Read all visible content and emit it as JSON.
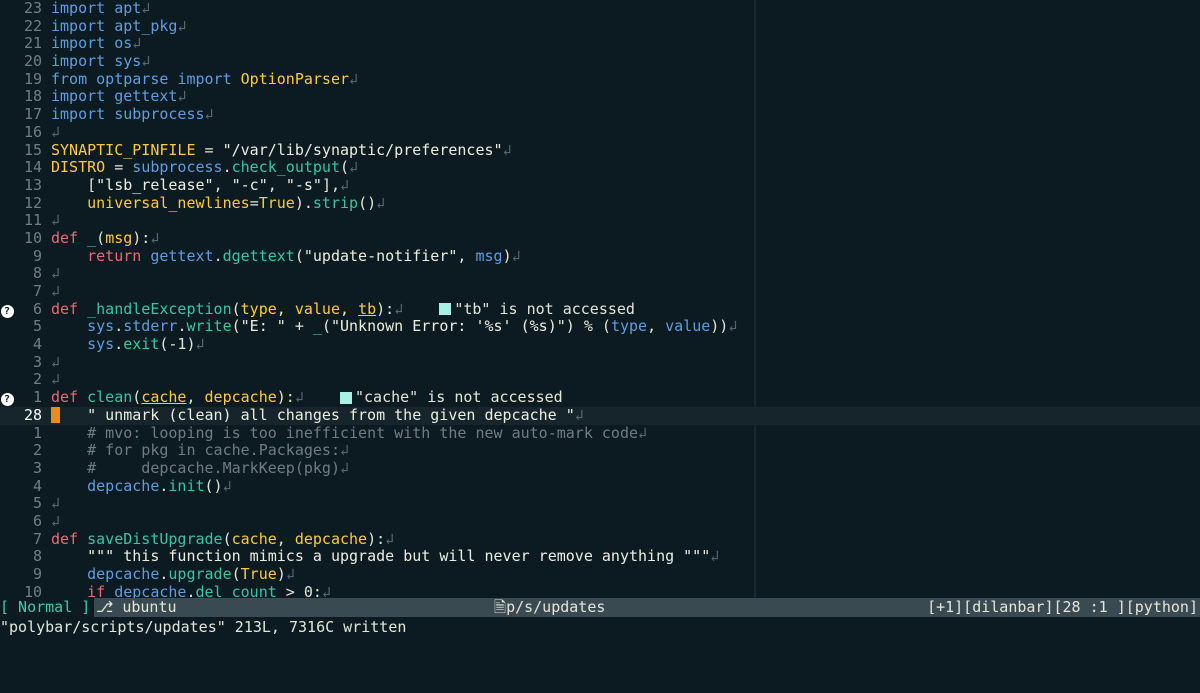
{
  "editor": {
    "lines": [
      {
        "n": "23",
        "tokens": [
          [
            "kw",
            "import"
          ],
          [
            "plain",
            " "
          ],
          [
            "kw",
            "apt"
          ],
          [
            "eol",
            "↲"
          ]
        ]
      },
      {
        "n": "22",
        "tokens": [
          [
            "kw",
            "import"
          ],
          [
            "plain",
            " "
          ],
          [
            "kw",
            "apt_pkg"
          ],
          [
            "eol",
            "↲"
          ]
        ]
      },
      {
        "n": "21",
        "tokens": [
          [
            "kw",
            "import"
          ],
          [
            "plain",
            " "
          ],
          [
            "kw",
            "os"
          ],
          [
            "eol",
            "↲"
          ]
        ]
      },
      {
        "n": "20",
        "tokens": [
          [
            "kw",
            "import"
          ],
          [
            "plain",
            " "
          ],
          [
            "kw",
            "sys"
          ],
          [
            "eol",
            "↲"
          ]
        ]
      },
      {
        "n": "19",
        "tokens": [
          [
            "kw",
            "from"
          ],
          [
            "plain",
            " "
          ],
          [
            "kw",
            "optparse"
          ],
          [
            "plain",
            " "
          ],
          [
            "kw",
            "import"
          ],
          [
            "plain",
            " "
          ],
          [
            "cnst",
            "OptionParser"
          ],
          [
            "eol",
            "↲"
          ]
        ]
      },
      {
        "n": "18",
        "tokens": [
          [
            "kw",
            "import"
          ],
          [
            "plain",
            " "
          ],
          [
            "kw",
            "gettext"
          ],
          [
            "eol",
            "↲"
          ]
        ]
      },
      {
        "n": "17",
        "tokens": [
          [
            "kw",
            "import"
          ],
          [
            "plain",
            " "
          ],
          [
            "kw",
            "subprocess"
          ],
          [
            "eol",
            "↲"
          ]
        ]
      },
      {
        "n": "16",
        "tokens": [
          [
            "eol",
            "↲"
          ]
        ]
      },
      {
        "n": "15",
        "tokens": [
          [
            "cnst",
            "SYNAPTIC_PINFILE"
          ],
          [
            "plain",
            " = "
          ],
          [
            "str",
            "\"/var/lib/synaptic/preferences\""
          ],
          [
            "eol",
            "↲"
          ]
        ]
      },
      {
        "n": "14",
        "tokens": [
          [
            "cnst",
            "DISTRO"
          ],
          [
            "plain",
            " = "
          ],
          [
            "kw",
            "subprocess"
          ],
          [
            "plain",
            "."
          ],
          [
            "fn",
            "check_output"
          ],
          [
            "plain",
            "("
          ],
          [
            "eol",
            "↲"
          ]
        ]
      },
      {
        "n": "13",
        "tokens": [
          [
            "plain",
            "    ["
          ],
          [
            "str",
            "\"lsb_release\""
          ],
          [
            "plain",
            ", "
          ],
          [
            "str",
            "\"-c\""
          ],
          [
            "plain",
            ", "
          ],
          [
            "str",
            "\"-s\""
          ],
          [
            "plain",
            "],"
          ],
          [
            "eol",
            "↲"
          ]
        ]
      },
      {
        "n": "12",
        "tokens": [
          [
            "plain",
            "    "
          ],
          [
            "var",
            "universal_newlines"
          ],
          [
            "plain",
            "="
          ],
          [
            "cnst",
            "True"
          ],
          [
            "plain",
            ")."
          ],
          [
            "fn",
            "strip"
          ],
          [
            "plain",
            "()"
          ],
          [
            "eol",
            "↲"
          ]
        ]
      },
      {
        "n": "11",
        "tokens": [
          [
            "eol",
            "↲"
          ]
        ]
      },
      {
        "n": "10",
        "tokens": [
          [
            "def",
            "def"
          ],
          [
            "plain",
            " "
          ],
          [
            "fn",
            "_"
          ],
          [
            "plain",
            "("
          ],
          [
            "var",
            "msg"
          ],
          [
            "plain",
            "):"
          ],
          [
            "eol",
            "↲"
          ]
        ]
      },
      {
        "n": "9",
        "tokens": [
          [
            "plain",
            "    "
          ],
          [
            "def",
            "return"
          ],
          [
            "plain",
            " "
          ],
          [
            "kw",
            "gettext"
          ],
          [
            "plain",
            "."
          ],
          [
            "fn",
            "dgettext"
          ],
          [
            "plain",
            "("
          ],
          [
            "str",
            "\"update-notifier\""
          ],
          [
            "plain",
            ", "
          ],
          [
            "kw",
            "msg"
          ],
          [
            "plain",
            ")"
          ],
          [
            "eol",
            "↲"
          ]
        ]
      },
      {
        "n": "8",
        "tokens": [
          [
            "eol",
            "↲"
          ]
        ]
      },
      {
        "n": "7",
        "tokens": [
          [
            "eol",
            "↲"
          ]
        ]
      },
      {
        "n": "6",
        "sign": "?",
        "tokens": [
          [
            "def",
            "def"
          ],
          [
            "plain",
            " "
          ],
          [
            "fn",
            "_handleException"
          ],
          [
            "plain",
            "("
          ],
          [
            "var",
            "type"
          ],
          [
            "plain",
            ", "
          ],
          [
            "var",
            "value"
          ],
          [
            "plain",
            ", "
          ],
          [
            "ul",
            "tb"
          ],
          [
            "plain",
            "):"
          ],
          [
            "eol",
            "↲"
          ],
          [
            "plain",
            "    "
          ],
          [
            "swatch",
            ""
          ],
          [
            "virt",
            "\"tb\" is not accessed"
          ]
        ]
      },
      {
        "n": "5",
        "tokens": [
          [
            "plain",
            "    "
          ],
          [
            "kw",
            "sys"
          ],
          [
            "plain",
            "."
          ],
          [
            "kw",
            "stderr"
          ],
          [
            "plain",
            "."
          ],
          [
            "fn",
            "write"
          ],
          [
            "plain",
            "("
          ],
          [
            "str",
            "\"E: \""
          ],
          [
            "plain",
            " + "
          ],
          [
            "fn",
            "_"
          ],
          [
            "plain",
            "("
          ],
          [
            "str",
            "\"Unknown Error: '%s' (%s)\""
          ],
          [
            "plain",
            ") % ("
          ],
          [
            "kw",
            "type"
          ],
          [
            "plain",
            ", "
          ],
          [
            "kw",
            "value"
          ],
          [
            "plain",
            "))"
          ],
          [
            "eol",
            "↲"
          ]
        ]
      },
      {
        "n": "4",
        "tokens": [
          [
            "plain",
            "    "
          ],
          [
            "kw",
            "sys"
          ],
          [
            "plain",
            "."
          ],
          [
            "fn",
            "exit"
          ],
          [
            "plain",
            "(-1)"
          ],
          [
            "eol",
            "↲"
          ]
        ]
      },
      {
        "n": "3",
        "tokens": [
          [
            "eol",
            "↲"
          ]
        ]
      },
      {
        "n": "2",
        "tokens": [
          [
            "eol",
            "↲"
          ]
        ]
      },
      {
        "n": "1",
        "sign": "?",
        "tokens": [
          [
            "def",
            "def"
          ],
          [
            "plain",
            " "
          ],
          [
            "fn",
            "clean"
          ],
          [
            "plain",
            "("
          ],
          [
            "ul",
            "cache"
          ],
          [
            "plain",
            ", "
          ],
          [
            "var",
            "depcache"
          ],
          [
            "plain",
            "):"
          ],
          [
            "eol",
            "↲"
          ],
          [
            "plain",
            "    "
          ],
          [
            "swatch",
            ""
          ],
          [
            "virt",
            "\"cache\" is not accessed"
          ]
        ]
      },
      {
        "n": "28",
        "current": true,
        "tokens": [
          [
            "cursor",
            ""
          ],
          [
            "plain",
            "   "
          ],
          [
            "str",
            "\" unmark (clean) all changes from the given depcache \""
          ],
          [
            "eol",
            "↲"
          ]
        ]
      },
      {
        "n": "1",
        "tokens": [
          [
            "plain",
            "    "
          ],
          [
            "cm",
            "# mvo: looping is too inefficient with the new auto-mark code"
          ],
          [
            "eol",
            "↲"
          ]
        ]
      },
      {
        "n": "2",
        "tokens": [
          [
            "plain",
            "    "
          ],
          [
            "cm",
            "# for pkg in cache.Packages:"
          ],
          [
            "eol",
            "↲"
          ]
        ]
      },
      {
        "n": "3",
        "tokens": [
          [
            "plain",
            "    "
          ],
          [
            "cm",
            "#     depcache.MarkKeep(pkg)"
          ],
          [
            "eol",
            "↲"
          ]
        ]
      },
      {
        "n": "4",
        "tokens": [
          [
            "plain",
            "    "
          ],
          [
            "kw",
            "depcache"
          ],
          [
            "plain",
            "."
          ],
          [
            "fn",
            "init"
          ],
          [
            "plain",
            "()"
          ],
          [
            "eol",
            "↲"
          ]
        ]
      },
      {
        "n": "5",
        "tokens": [
          [
            "eol",
            "↲"
          ]
        ]
      },
      {
        "n": "6",
        "tokens": [
          [
            "eol",
            "↲"
          ]
        ]
      },
      {
        "n": "7",
        "tokens": [
          [
            "def",
            "def"
          ],
          [
            "plain",
            " "
          ],
          [
            "fn",
            "saveDistUpgrade"
          ],
          [
            "plain",
            "("
          ],
          [
            "var",
            "cache"
          ],
          [
            "plain",
            ", "
          ],
          [
            "var",
            "depcache"
          ],
          [
            "plain",
            "):"
          ],
          [
            "eol",
            "↲"
          ]
        ]
      },
      {
        "n": "8",
        "tokens": [
          [
            "plain",
            "    "
          ],
          [
            "str",
            "\"\"\" this function mimics a upgrade but will never remove anything \"\"\""
          ],
          [
            "eol",
            "↲"
          ]
        ]
      },
      {
        "n": "9",
        "tokens": [
          [
            "plain",
            "    "
          ],
          [
            "kw",
            "depcache"
          ],
          [
            "plain",
            "."
          ],
          [
            "fn",
            "upgrade"
          ],
          [
            "plain",
            "("
          ],
          [
            "cnst",
            "True"
          ],
          [
            "plain",
            ")"
          ],
          [
            "eol",
            "↲"
          ]
        ]
      },
      {
        "n": "10",
        "tokens": [
          [
            "plain",
            "    "
          ],
          [
            "def",
            "if"
          ],
          [
            "plain",
            " "
          ],
          [
            "kw",
            "depcache"
          ],
          [
            "plain",
            "."
          ],
          [
            "fn",
            "del_count"
          ],
          [
            "plain",
            " > 0:"
          ],
          [
            "eol",
            "↲"
          ]
        ]
      }
    ]
  },
  "status": {
    "mode": "[ Normal ]",
    "branch": " ubuntu",
    "file": "p/s/updates",
    "right": "[+1][dilanbar][28 :1 ][python]"
  },
  "cmdline": "\"polybar/scripts/updates\" 213L, 7316C written",
  "colors": {
    "background": "#0c1b21",
    "keyword": "#5d9ee0",
    "def": "#ea6a76",
    "function": "#33c7a5",
    "constant": "#ffca3d",
    "mode": "#35d0a8",
    "cursor": "#e98c1e"
  },
  "icons": {
    "branch": "branch-icon",
    "file": "file-icon",
    "hint": "question-hint-icon"
  }
}
